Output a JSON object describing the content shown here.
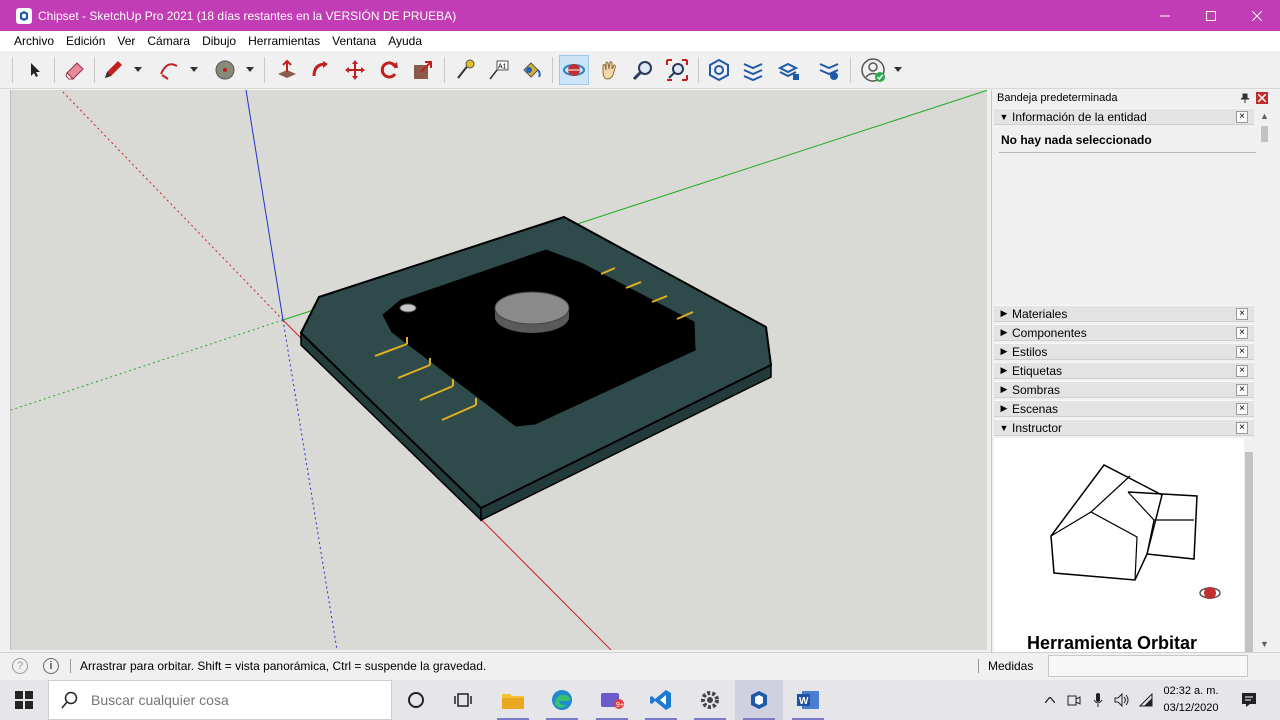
{
  "window": {
    "title": "Chipset - SketchUp Pro 2021 (18 días restantes en la VERSIÓN DE PRUEBA)"
  },
  "menu": [
    "Archivo",
    "Edición",
    "Ver",
    "Cámara",
    "Dibujo",
    "Herramientas",
    "Ventana",
    "Ayuda"
  ],
  "toolbar": {
    "tools": [
      "select-tool",
      "eraser-tool",
      "line-tool",
      "arc-tool",
      "shapes-tool",
      "push-pull-tool",
      "offset-tool",
      "move-tool",
      "rotate-tool",
      "scale-tool",
      "tape-measure-tool",
      "text-tool",
      "paint-bucket-tool",
      "orbit-tool",
      "pan-tool",
      "zoom-tool",
      "zoom-extents-tool",
      "warehouse-tool",
      "extension-warehouse-tool",
      "layout-tool",
      "extension-manager-tool",
      "profile-tool"
    ],
    "active_tool": "orbit-tool"
  },
  "tray": {
    "title": "Bandeja predeterminada",
    "entity_info": {
      "label": "Información de la entidad",
      "message": "No hay nada seleccionado"
    },
    "panels": [
      "Materiales",
      "Componentes",
      "Estilos",
      "Etiquetas",
      "Sombras",
      "Escenas",
      "Instructor"
    ],
    "instructor": {
      "heading": "Herramienta Orbitar"
    }
  },
  "statusbar": {
    "hint": "Arrastrar para orbitar. Shift = vista panorámica, Ctrl = suspende la gravedad.",
    "measure_label": "Medidas",
    "measure_value": ""
  },
  "taskbar": {
    "search_placeholder": "Buscar cualquier cosa",
    "apps": [
      "cortana",
      "task-view",
      "file-explorer",
      "edge",
      "mail",
      "vscode",
      "settings",
      "sketchup",
      "word"
    ],
    "time": "02:32 a. m.",
    "date": "03/12/2020"
  },
  "colors": {
    "titlebar": "#c23cb5",
    "viewport_bg": "#d9d9d6",
    "board": "#2e4a4a",
    "chip": "#000000",
    "pins": "#e0b020",
    "axis_red": "#cc2222",
    "axis_green": "#22aa22",
    "axis_blue": "#2233cc"
  }
}
